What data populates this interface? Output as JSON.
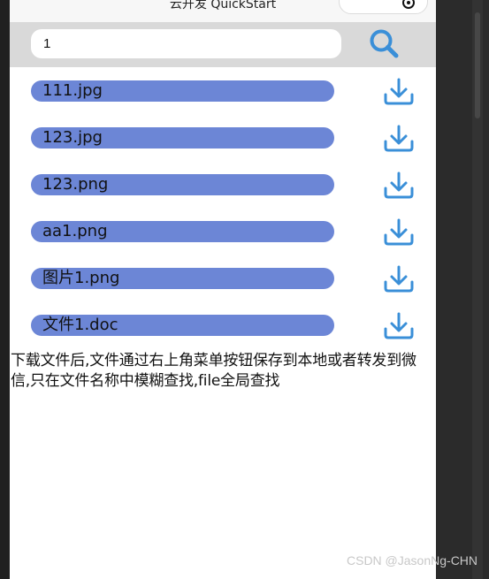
{
  "navbar": {
    "title": "云开发 QuickStart"
  },
  "search": {
    "value": "1",
    "placeholder": ""
  },
  "files": [
    {
      "name": "111.jpg"
    },
    {
      "name": "123.jpg"
    },
    {
      "name": "123.png"
    },
    {
      "name": "aa1.png"
    },
    {
      "name": "图片1.png"
    },
    {
      "name": "文件1.doc"
    }
  ],
  "note": "下载文件后,文件通过右上角菜单按钮保存到本地或者转发到微信,只在文件名称中模糊查找,file全局查找",
  "watermark": "CSDN @JasonNg-CHN",
  "colors": {
    "pill": "#6c86d6",
    "icon": "#3a8fd8",
    "search_bar_bg": "#d9d9d9"
  },
  "icons": {
    "search": "search-icon",
    "download": "download-icon",
    "capsule": "record-icon"
  }
}
